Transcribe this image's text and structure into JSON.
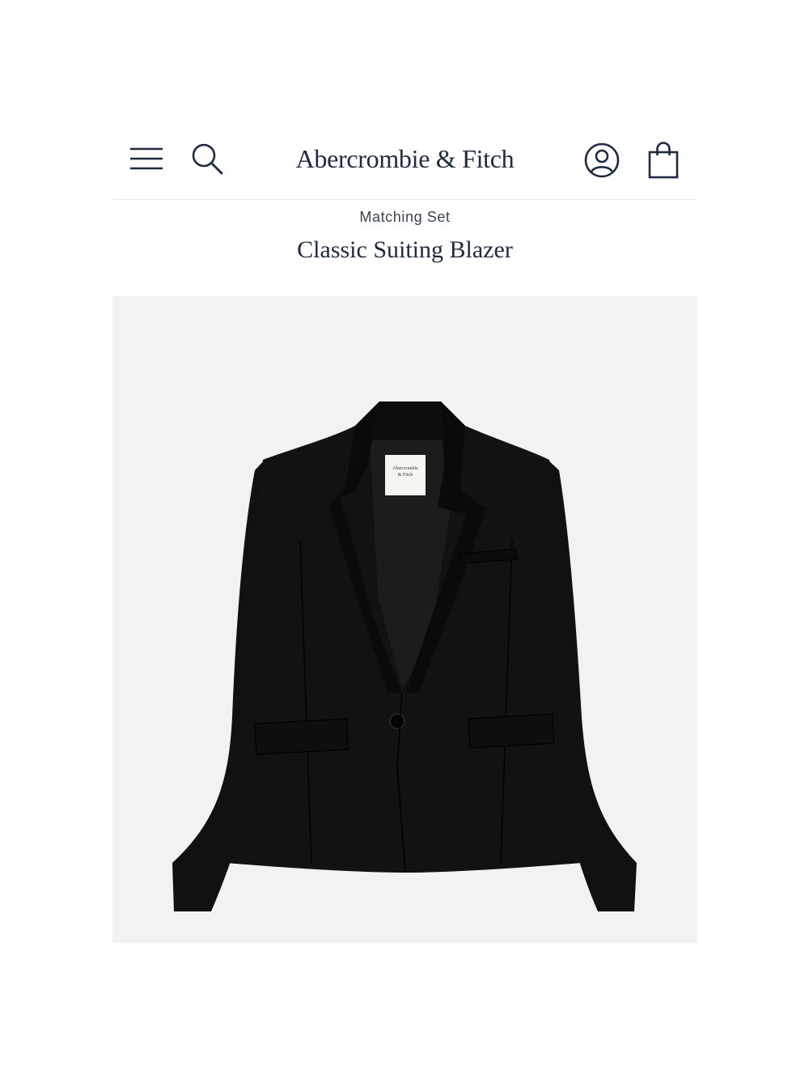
{
  "header": {
    "brand": "Abercrombie & Fitch",
    "icons": {
      "menu": "hamburger-menu-icon",
      "search": "search-icon",
      "account": "account-icon",
      "bag": "shopping-bag-icon"
    }
  },
  "product": {
    "collection_label": "Matching Set",
    "name": "Classic Suiting Blazer",
    "image": {
      "subject": "black single-button blazer",
      "garment_color": "#111111",
      "background_color": "#f2f2f2"
    },
    "label_text": {
      "brand_line1": "Abercrombie",
      "brand_line2": "& Fitch"
    }
  },
  "colors": {
    "text_primary": "#1d2a3f",
    "text_secondary": "#3a4354"
  }
}
